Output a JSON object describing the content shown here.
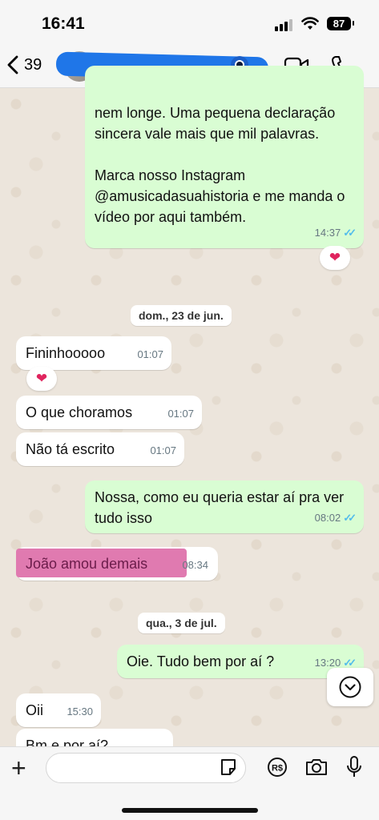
{
  "status_bar": {
    "time": "16:41",
    "battery": "87"
  },
  "header": {
    "back_count": "39",
    "contact_name": ""
  },
  "messages": {
    "m1_text": "nem longe. Uma pequena declaração sincera vale mais que mil palavras.\n\nMarca nosso Instagram @amusicadasuahistoria e me manda o vídeo por aqui também.",
    "m1_time": "14:37",
    "m1_reaction": "❤",
    "date1": "dom., 23 de jun.",
    "m2_text": "Fininhooooo",
    "m2_time": "01:07",
    "m2_reaction": "❤",
    "m3_text": "O que choramos",
    "m3_time": "01:07",
    "m4_text": "Não tá escrito",
    "m4_time": "01:07",
    "m5_text": "Nossa, como eu queria estar aí pra ver tudo isso",
    "m5_time": "08:02",
    "m6_text": "João amou demais",
    "m6_time": "08:34",
    "date2": "qua., 3 de jul.",
    "m7_text": "Oie. Tudo bem por aí ?",
    "m7_time": "13:20",
    "m8_text": "Oii",
    "m8_time": "15:30",
    "m9_text": "Bm e por aí?"
  },
  "colors": {
    "outgoing": "#d9fdd3",
    "incoming": "#ffffff",
    "tick_read": "#53bdeb",
    "highlight": "#e07ab0"
  },
  "icons": [
    "back-icon",
    "video-call-icon",
    "phone-icon",
    "scroll-down-icon",
    "plus-icon",
    "sticker-icon",
    "pix-icon",
    "camera-icon",
    "mic-icon"
  ]
}
